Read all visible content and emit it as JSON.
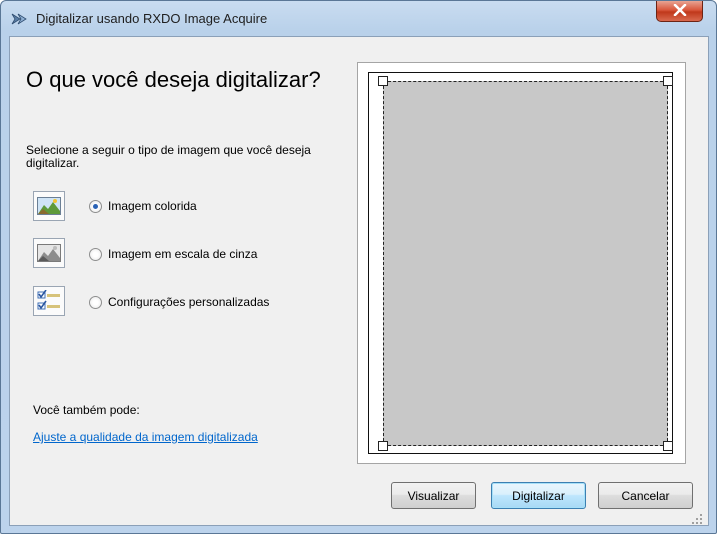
{
  "window": {
    "title": "Digitalizar usando RXDO Image Acquire",
    "close_glyph": "X"
  },
  "main": {
    "heading": "O que você deseja digitalizar?",
    "description": "Selecione a seguir o tipo de imagem que você deseja digitalizar."
  },
  "options": [
    {
      "label": "Imagem colorida",
      "icon": "color-image-icon",
      "checked": true
    },
    {
      "label": "Imagem em escala de cinza",
      "icon": "grayscale-image-icon",
      "checked": false
    },
    {
      "label": "Configurações personalizadas",
      "icon": "custom-settings-icon",
      "checked": false
    }
  ],
  "footer": {
    "also_label": "Você também pode:",
    "link_text": "Ajuste a qualidade da imagem digitalizada"
  },
  "buttons": {
    "preview": "Visualizar",
    "scan": "Digitalizar",
    "cancel": "Cancelar"
  },
  "colors": {
    "scan_area": "#c8c8c8",
    "link": "#0066cc",
    "close_button": "#c0381b"
  }
}
